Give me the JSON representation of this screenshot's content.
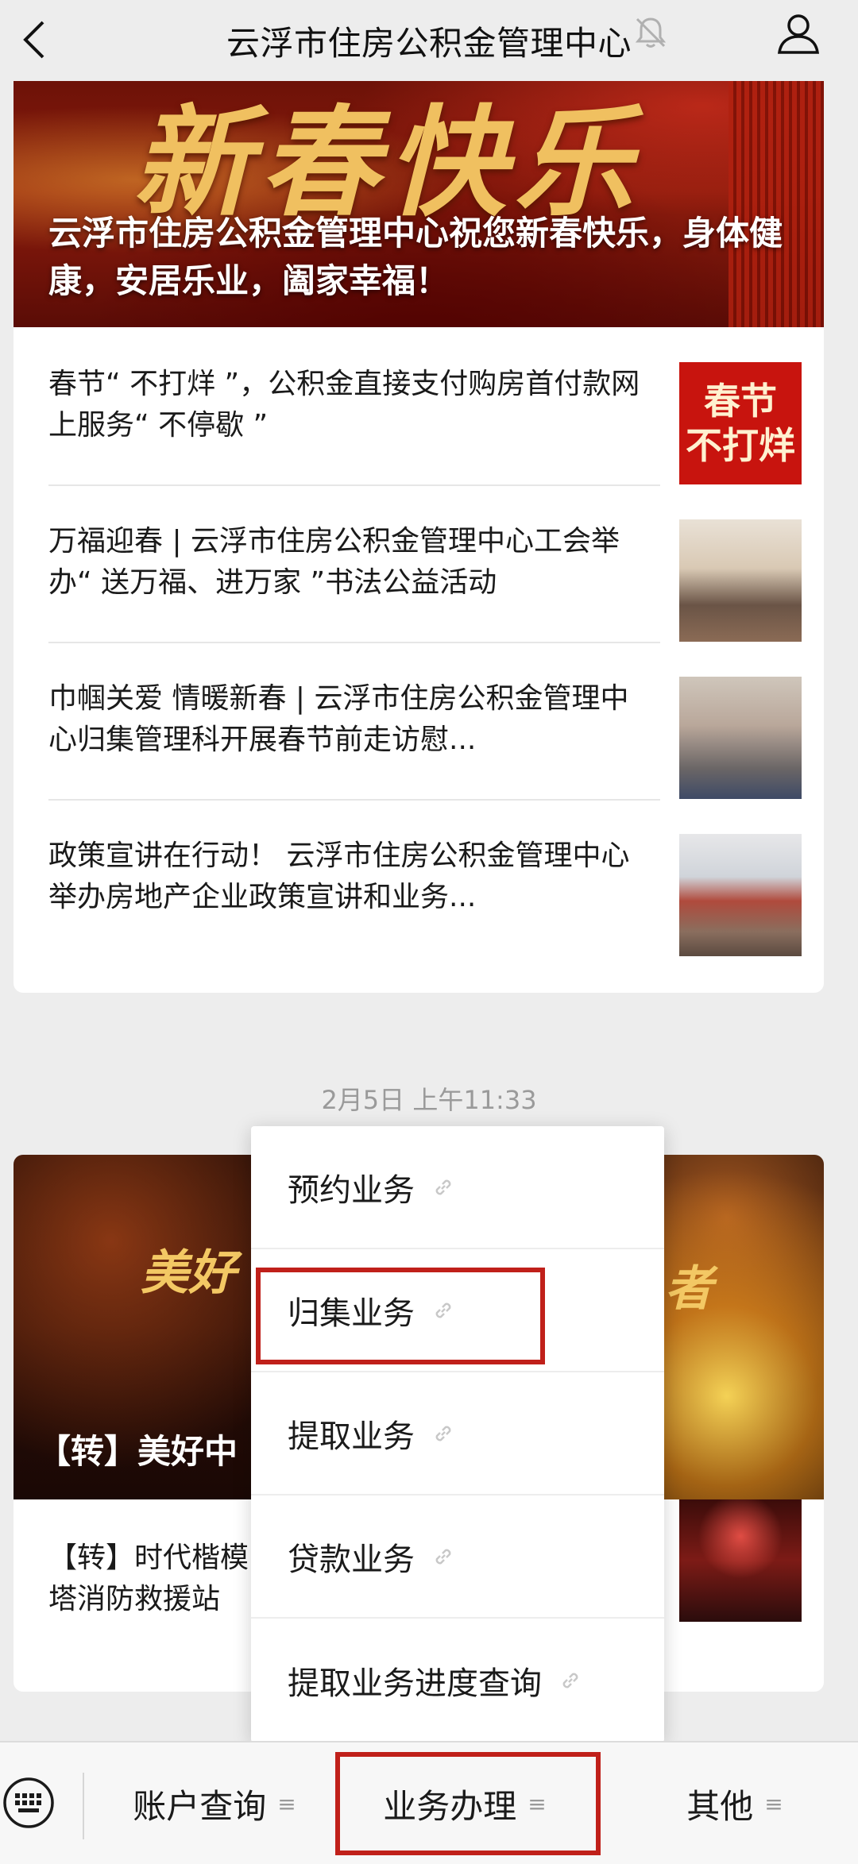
{
  "header": {
    "title": "云浮市住房公积金管理中心",
    "back_icon": "chevron-left-icon",
    "mute_icon": "bell-muted-icon",
    "profile_icon": "person-icon"
  },
  "article1": {
    "hero_art_text": "新春快乐",
    "hero_caption": "云浮市住房公积金管理中心祝您新春快乐，身体健康，安居乐业，阖家幸福！",
    "items": [
      {
        "title": "春节“ 不打烊 ”，公积金直接支付购房首付款网上服务“ 不停歇 ”",
        "thumb_text_line1": "春节",
        "thumb_text_line2": "不打烊"
      },
      {
        "title": "万福迎春 | 云浮市住房公积金管理中心工会举办“ 送万福、进万家 ”书法公益活动"
      },
      {
        "title": "巾帼关爱 情暖新春 | 云浮市住房公积金管理中心归集管理科开展春节前走访慰..."
      },
      {
        "title": "政策宣讲在行动！ 云浮市住房公积金管理中心举办房地产企业政策宣讲和业务..."
      }
    ]
  },
  "timestamp": "2月5日 上午11:33",
  "article2": {
    "hero_art_left": "美好",
    "hero_art_right": "者",
    "hero_caption": "【转】美好中",
    "item_line1": "【转】时代楷模",
    "item_line2": "塔消防救援站"
  },
  "popup_menu": {
    "items": [
      {
        "label": "预约业务"
      },
      {
        "label": "归集业务"
      },
      {
        "label": "提取业务"
      },
      {
        "label": "贷款业务"
      },
      {
        "label": "提取业务进度查询"
      }
    ]
  },
  "bottom_bar": {
    "keyboard_icon": "keyboard-icon",
    "tabs": [
      {
        "label": "账户查询",
        "glyph": "≡"
      },
      {
        "label": "业务办理",
        "glyph": "≡"
      },
      {
        "label": "其他",
        "glyph": "≡"
      }
    ]
  },
  "colors": {
    "background": "#ededed",
    "highlight": "#c0201a",
    "card": "#ffffff"
  }
}
